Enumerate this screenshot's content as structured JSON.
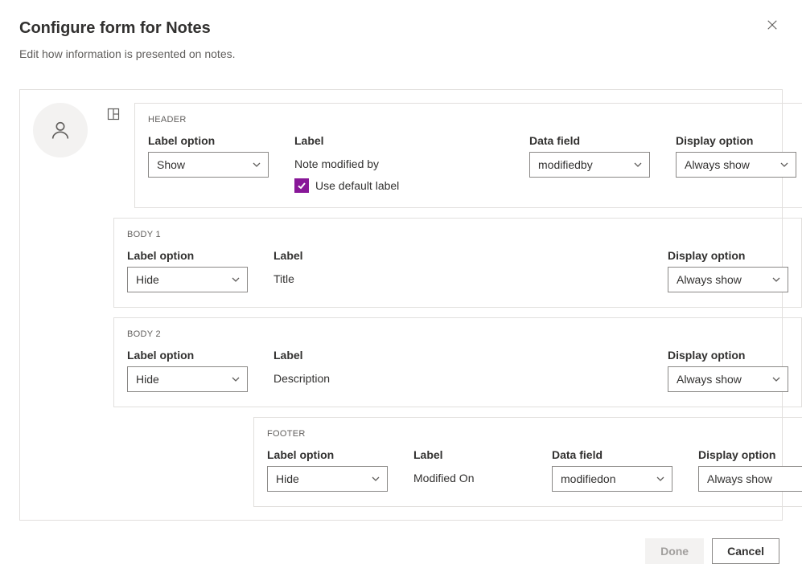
{
  "dialog": {
    "title": "Configure form for Notes",
    "subtitle": "Edit how information is presented on notes."
  },
  "sections": {
    "header": {
      "name": "HEADER",
      "labels": {
        "labelOption": "Label option",
        "label": "Label",
        "dataField": "Data field",
        "displayOption": "Display option"
      },
      "values": {
        "labelOption": "Show",
        "label": "Note modified by",
        "dataField": "modifiedby",
        "displayOption": "Always show"
      },
      "checkbox": {
        "label": "Use default label",
        "checked": true
      }
    },
    "body1": {
      "name": "BODY 1",
      "labels": {
        "labelOption": "Label option",
        "label": "Label",
        "displayOption": "Display option"
      },
      "values": {
        "labelOption": "Hide",
        "label": "Title",
        "displayOption": "Always show"
      }
    },
    "body2": {
      "name": "BODY 2",
      "labels": {
        "labelOption": "Label option",
        "label": "Label",
        "displayOption": "Display option"
      },
      "values": {
        "labelOption": "Hide",
        "label": "Description",
        "displayOption": "Always show"
      }
    },
    "footer": {
      "name": "FOOTER",
      "labels": {
        "labelOption": "Label option",
        "label": "Label",
        "dataField": "Data field",
        "displayOption": "Display option"
      },
      "values": {
        "labelOption": "Hide",
        "label": "Modified On",
        "dataField": "modifiedon",
        "displayOption": "Always show"
      }
    }
  },
  "buttons": {
    "done": "Done",
    "cancel": "Cancel"
  }
}
